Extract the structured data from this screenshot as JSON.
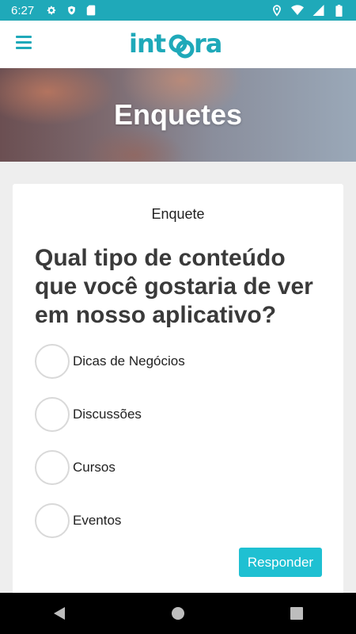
{
  "status_bar": {
    "time": "6:27",
    "left_icons": [
      "gear-icon",
      "shield-icon",
      "sd-card-icon"
    ],
    "right_icons": [
      "location-icon",
      "wifi-icon",
      "signal-icon",
      "battery-icon"
    ]
  },
  "app_bar": {
    "logo_text": "integra",
    "menu_icon": "hamburger-menu-icon"
  },
  "hero": {
    "title": "Enquetes"
  },
  "poll": {
    "card_title": "Enquete",
    "question": "Qual tipo de conteúdo que você gostaria de ver em nosso aplicativo?",
    "options": [
      {
        "label": "Dicas de Negócios"
      },
      {
        "label": "Discussões"
      },
      {
        "label": "Cursos"
      },
      {
        "label": "Eventos"
      }
    ],
    "submit_label": "Responder"
  },
  "nav_bar": {
    "buttons": [
      "back-icon",
      "home-icon",
      "recents-icon"
    ]
  },
  "colors": {
    "accent": "#1fa9b9",
    "button": "#1fc0d2",
    "background": "#eeeeee"
  }
}
